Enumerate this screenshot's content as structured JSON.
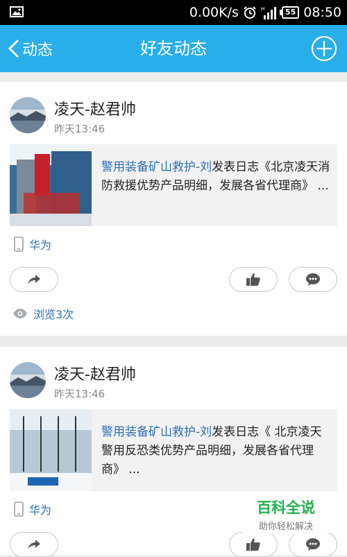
{
  "status_bar": {
    "speed": "0.00K/s",
    "battery": "55",
    "time": "08:50",
    "icons": [
      "gallery-icon",
      "alarm-clock-icon",
      "signal-icon",
      "battery-icon"
    ]
  },
  "nav": {
    "back_label": "动态",
    "title": "好友动态",
    "accent_color": "#28aee8"
  },
  "posts": [
    {
      "user_name": "凌天-赵君帅",
      "time": "昨天13:46",
      "share": {
        "author": "警用装备矿山救护-刘",
        "text": "发表日志《北京凌天消防救援优势产品明细，发展各省代理商》 ..."
      },
      "device": "华为",
      "views": "浏览3次"
    },
    {
      "user_name": "凌天-赵君帅",
      "time": "昨天13:46",
      "share": {
        "author": "警用装备矿山救护-刘",
        "text": "发表日志《 北京凌天警用反恐类优势产品明细，发展各省代理商》 ..."
      },
      "device": "华为"
    }
  ],
  "watermark": {
    "title": "百科全说",
    "subtitle": "助你轻松解决"
  }
}
